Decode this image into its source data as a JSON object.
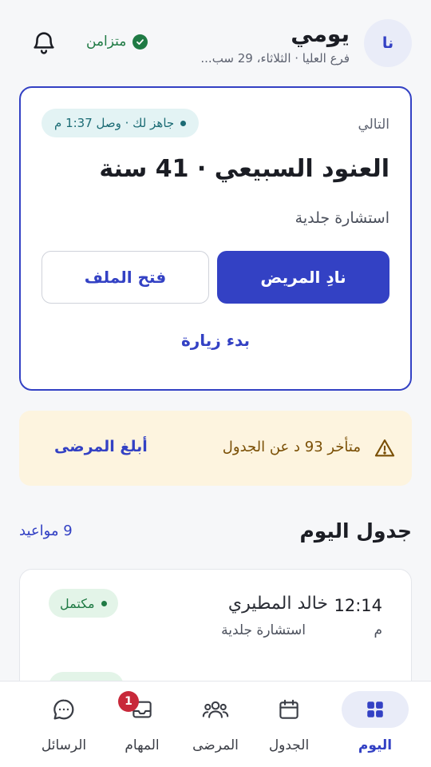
{
  "header": {
    "avatar_initials": "نا",
    "title": "يومي",
    "subtitle": "فرع العليا · الثلاثاء، 29 سب...",
    "sync_label": "متزامن"
  },
  "next_card": {
    "label": "التالي",
    "ready_status": "جاهز لك · وصل 1:37 م",
    "patient": "العنود السبيعي · 41 سنة",
    "visit_type": "استشارة جلدية",
    "call_button": "نادِ المريض",
    "open_file_button": "فتح الملف",
    "start_visit": "بدء زيارة"
  },
  "alert": {
    "text": "متأخر 93 د عن الجدول",
    "action": "أبلغ المرضى"
  },
  "schedule": {
    "title": "جدول اليوم",
    "count": "9 مواعيد",
    "items": [
      {
        "time": "12:14",
        "ampm": "م",
        "name": "خالد المطيري",
        "type": "استشارة جلدية",
        "status": "مكتمل"
      }
    ]
  },
  "nav": {
    "items": [
      {
        "label": "اليوم",
        "icon": "grid-icon",
        "active": true
      },
      {
        "label": "الجدول",
        "icon": "calendar-icon",
        "active": false
      },
      {
        "label": "المرضى",
        "icon": "users-icon",
        "active": false
      },
      {
        "label": "المهام",
        "icon": "inbox-icon",
        "active": false,
        "badge": "1"
      },
      {
        "label": "الرسائل",
        "icon": "chat-icon",
        "active": false
      }
    ]
  },
  "colors": {
    "accent": "#3341c4",
    "success": "#1f7a44",
    "warning_bg": "#fdf4df",
    "warning_text": "#7a4f05",
    "badge": "#c8283a"
  }
}
